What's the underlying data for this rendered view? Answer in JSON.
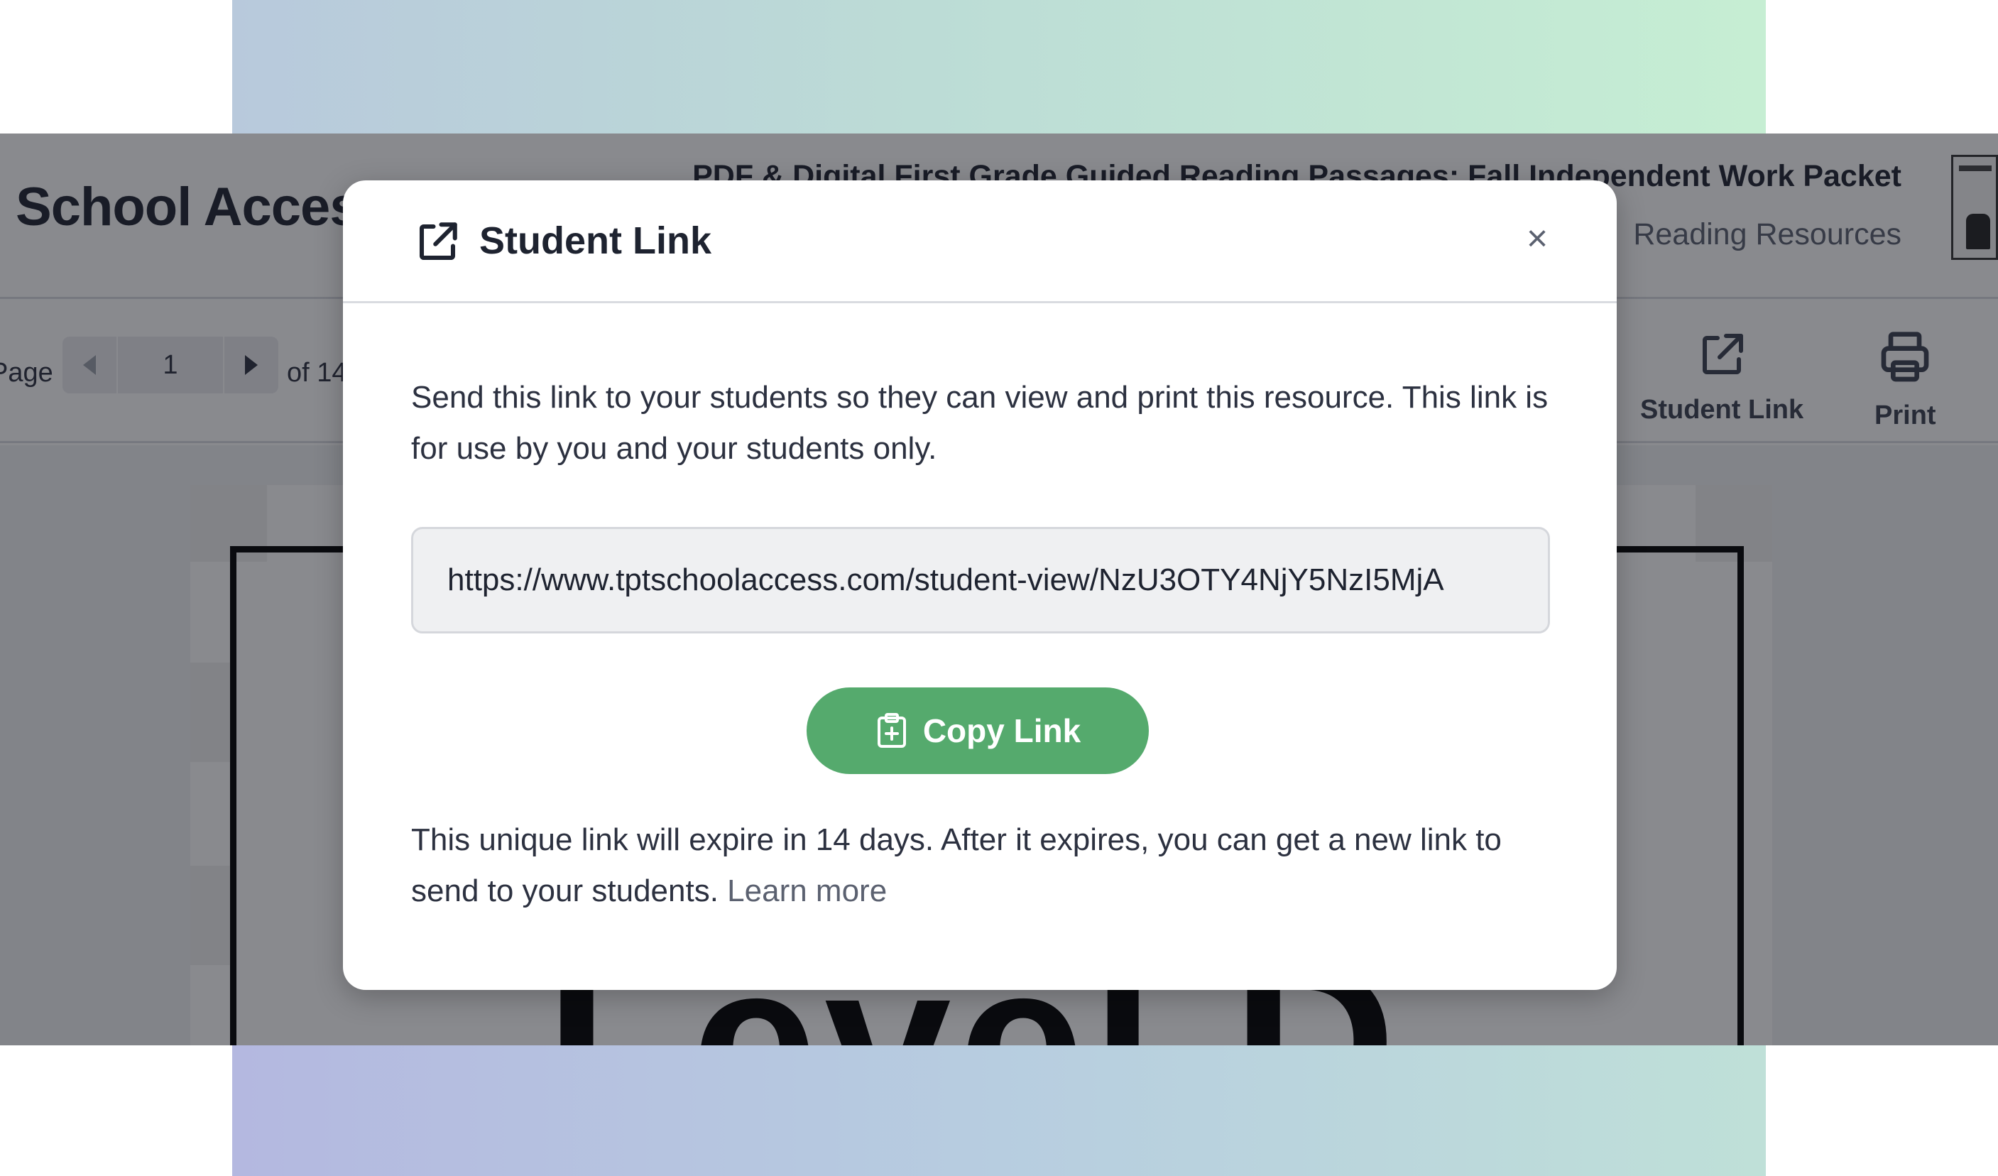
{
  "app": {
    "brand": "School Access",
    "resource_title": "PDF & Digital First Grade Guided Reading Passages: Fall Independent Work Packet",
    "resource_subtitle": "Reading Resources",
    "page_label": "Page",
    "page_value": "1",
    "page_of": "of 14",
    "toolbar": {
      "student_link_label": "Student Link",
      "print_label": "Print"
    },
    "document_preview_text": "Level D"
  },
  "modal": {
    "title": "Student Link",
    "close_symbol": "×",
    "description": "Send this link to your students so they can view and print this resource. This link is for use by you and your students only.",
    "link_value": "https://www.tptschoolaccess.com/student-view/NzU3OTY4NjY5NzI5MjA",
    "copy_button_label": "Copy Link",
    "footer_text": "This unique link will expire in 14 days. After it expires, you can get a new link to send to your students. ",
    "learn_more_label": "Learn more"
  },
  "colors": {
    "accent_green": "#55aa6d",
    "text_dark": "#1e2330",
    "overlay": "rgba(20,22,30,0.5)"
  },
  "icons": {
    "modal_header": "external-link-icon",
    "close": "close-icon",
    "copy": "clipboard-plus-icon",
    "print": "printer-icon",
    "pager_prev": "caret-left-icon",
    "pager_next": "caret-right-icon"
  }
}
